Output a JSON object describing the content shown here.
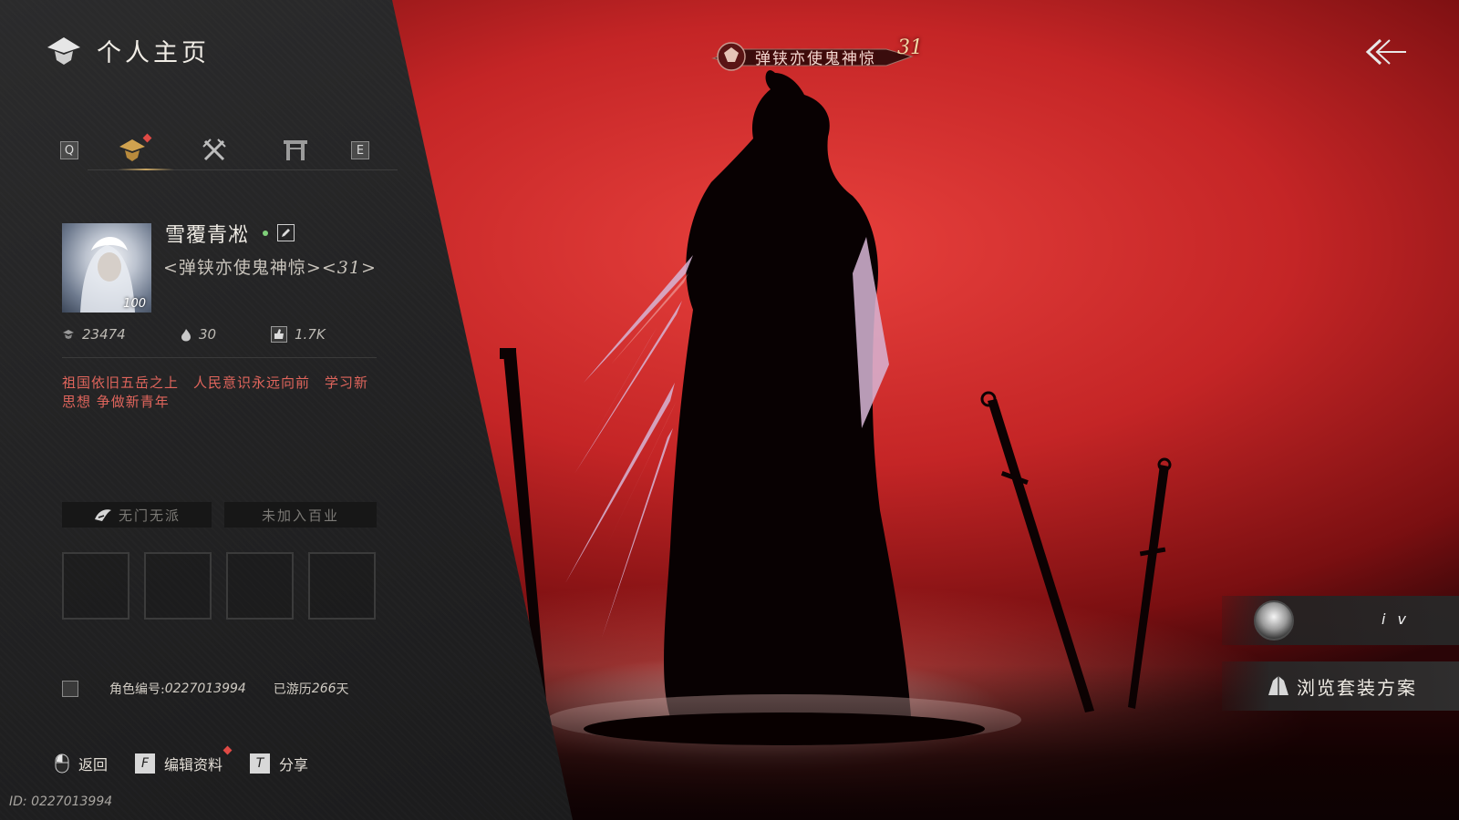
{
  "header": {
    "title": "个人主页"
  },
  "tabs": {
    "left_key": "Q",
    "right_key": "E",
    "items": [
      {
        "icon": "profile-emblem-icon",
        "active": true
      },
      {
        "icon": "crossed-swords-icon",
        "active": false
      },
      {
        "icon": "gate-icon",
        "active": false
      }
    ]
  },
  "profile": {
    "name": "雪覆青凇",
    "guild_prefix": "<弹铗亦使鬼神惊><",
    "guild_level": "31",
    "guild_suffix": ">",
    "avatar_level": "100",
    "stats": {
      "power": "23474",
      "fire": "30",
      "likes": "1.7K"
    },
    "signature": "祖国依旧五岳之上　人民意识永远向前　学习新思想 争做新青年",
    "faction": "无门无派",
    "profession": "未加入百业",
    "role_id_label": "角色编号: ",
    "role_id": "0227013994",
    "days_label": "已游历",
    "days": "266",
    "days_unit": "天"
  },
  "footer": {
    "back_label": "返回",
    "edit_key": "F",
    "edit_label": "编辑资料",
    "share_key": "T",
    "share_label": "分享",
    "id_text": "ID: 0227013994"
  },
  "title_banner": {
    "text": "弹铗亦使鬼神惊",
    "level": "31"
  },
  "right_panel": {
    "friend_name": "i v",
    "outfit_label": "浏览套装方案"
  },
  "colors": {
    "accent_gold": "#c7a462",
    "signature_red": "#e0655c",
    "notify_red": "#e04a45",
    "scene_red": "#c42526"
  }
}
